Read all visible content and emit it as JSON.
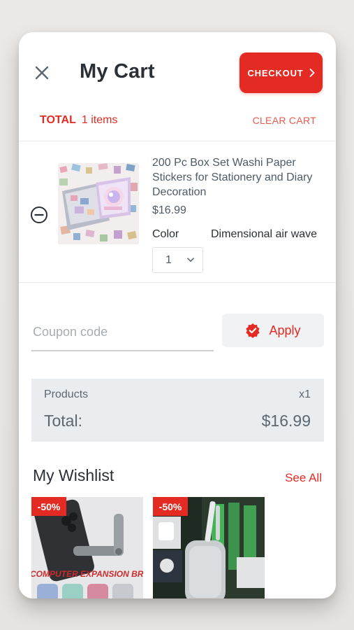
{
  "header": {
    "title": "My Cart",
    "checkout_label": "CHECKOUT"
  },
  "summary_bar": {
    "total_label": "TOTAL",
    "items_count": "1 items",
    "clear_cart_label": "CLEAR CART"
  },
  "cart_items": [
    {
      "name": "200 Pc Box Set Washi Paper Stickers for Stationery and Diary Decoration",
      "price": "$16.99",
      "option_label": "Color",
      "option_value": "Dimensional air wave",
      "quantity": "1"
    }
  ],
  "coupon": {
    "placeholder": "Coupon code",
    "value": "",
    "apply_label": "Apply"
  },
  "order_summary": {
    "products_label": "Products",
    "products_qty": "x1",
    "total_label": "Total:",
    "total_value": "$16.99"
  },
  "wishlist": {
    "title": "My Wishlist",
    "see_all_label": "See All",
    "items": [
      {
        "discount": "-50%",
        "banner_text": "COMPUTER EXPANSION BRACKET"
      },
      {
        "discount": "-50%"
      }
    ]
  },
  "colors": {
    "accent": "#e32b23",
    "text_dark": "#2b3036",
    "text_muted": "#5d6770",
    "summary_bg": "#e9edf0"
  }
}
